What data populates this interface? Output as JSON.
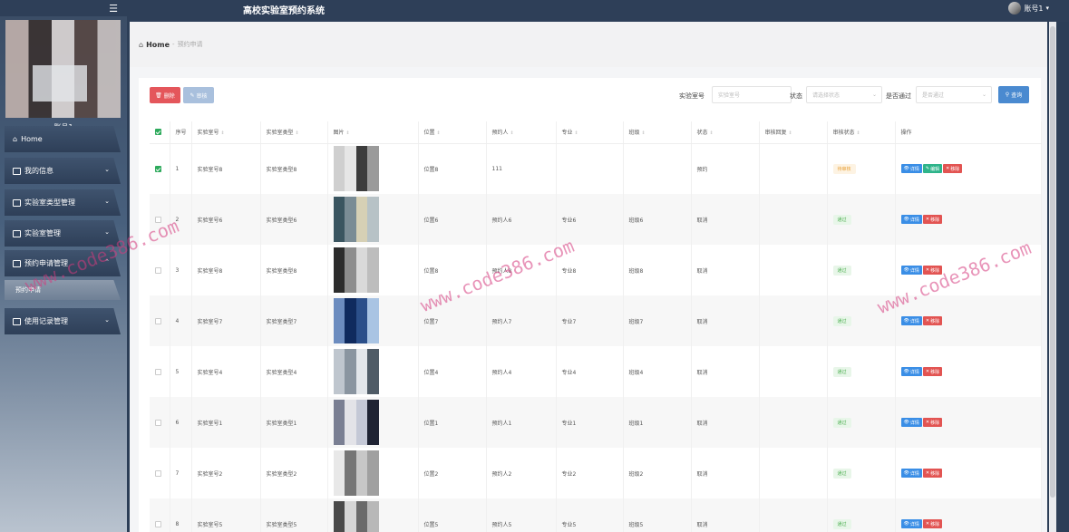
{
  "app_title": "高校实验室预约系统",
  "user": {
    "name": "账号1"
  },
  "sidebar": {
    "username": "账号1",
    "items": [
      {
        "label": "Home",
        "icon": "home-icon"
      },
      {
        "label": "我的信息",
        "icon": "card-icon"
      },
      {
        "label": "实验室类型管理",
        "icon": "clipboard-icon"
      },
      {
        "label": "实验室管理",
        "icon": "clipboard-icon"
      },
      {
        "label": "预约申请管理",
        "icon": "folder-icon"
      },
      {
        "label": "使用记录管理",
        "icon": "check-icon"
      }
    ],
    "active_sub": "预约申请"
  },
  "breadcrumb": {
    "home": "Home",
    "sep": "-",
    "current": "预约申请"
  },
  "toolbar": {
    "delete_label": "删除",
    "audit_label": "审核",
    "search_label": "查询",
    "filters": [
      {
        "label": "实验室号",
        "placeholder": "实验室号"
      },
      {
        "label": "状态",
        "placeholder": "请选择状态"
      },
      {
        "label": "是否通过",
        "placeholder": "是否通过"
      }
    ]
  },
  "table": {
    "columns": [
      "序号",
      "实验室号",
      "实验室类型",
      "图片",
      "位置",
      "预约人",
      "专业",
      "班级",
      "状态",
      "审核回复",
      "审核状态",
      "操作"
    ],
    "rows": [
      {
        "no": "1",
        "lab": "实验室号8",
        "type": "实验室类型8",
        "location": "位置8",
        "person": "111",
        "major": "",
        "class": "",
        "status": "预约",
        "reply": "",
        "audit": "待审核",
        "audit_kind": "pending",
        "checked": true,
        "has_edit": true
      },
      {
        "no": "2",
        "lab": "实验室号6",
        "type": "实验室类型6",
        "location": "位置6",
        "person": "预约人6",
        "major": "专业6",
        "class": "班级6",
        "status": "取消",
        "reply": "",
        "audit": "通过",
        "audit_kind": "pass",
        "checked": false,
        "has_edit": false
      },
      {
        "no": "3",
        "lab": "实验室号8",
        "type": "实验室类型8",
        "location": "位置8",
        "person": "预约人8",
        "major": "专业8",
        "class": "班级8",
        "status": "取消",
        "reply": "",
        "audit": "通过",
        "audit_kind": "pass",
        "checked": false,
        "has_edit": false
      },
      {
        "no": "4",
        "lab": "实验室号7",
        "type": "实验室类型7",
        "location": "位置7",
        "person": "预约人7",
        "major": "专业7",
        "class": "班级7",
        "status": "取消",
        "reply": "",
        "audit": "通过",
        "audit_kind": "pass",
        "checked": false,
        "has_edit": false
      },
      {
        "no": "5",
        "lab": "实验室号4",
        "type": "实验室类型4",
        "location": "位置4",
        "person": "预约人4",
        "major": "专业4",
        "class": "班级4",
        "status": "取消",
        "reply": "",
        "audit": "通过",
        "audit_kind": "pass",
        "checked": false,
        "has_edit": false
      },
      {
        "no": "6",
        "lab": "实验室号1",
        "type": "实验室类型1",
        "location": "位置1",
        "person": "预约人1",
        "major": "专业1",
        "class": "班级1",
        "status": "取消",
        "reply": "",
        "audit": "通过",
        "audit_kind": "pass",
        "checked": false,
        "has_edit": false
      },
      {
        "no": "7",
        "lab": "实验室号2",
        "type": "实验室类型2",
        "location": "位置2",
        "person": "预约人2",
        "major": "专业2",
        "class": "班级2",
        "status": "取消",
        "reply": "",
        "audit": "通过",
        "audit_kind": "pass",
        "checked": false,
        "has_edit": false
      },
      {
        "no": "8",
        "lab": "实验室号5",
        "type": "实验室类型5",
        "location": "位置5",
        "person": "预约人5",
        "major": "专业5",
        "class": "班级5",
        "status": "取消",
        "reply": "",
        "audit": "通过",
        "audit_kind": "pass",
        "checked": false,
        "has_edit": false
      }
    ],
    "action_labels": {
      "view": "详情",
      "edit": "编辑",
      "remove": "移除"
    }
  },
  "watermark": "www.code386.com",
  "colors": {
    "accent": "#4a8ad0",
    "danger": "#e4565b",
    "success": "#2eaa5c",
    "topbar": "#2e3f58"
  }
}
